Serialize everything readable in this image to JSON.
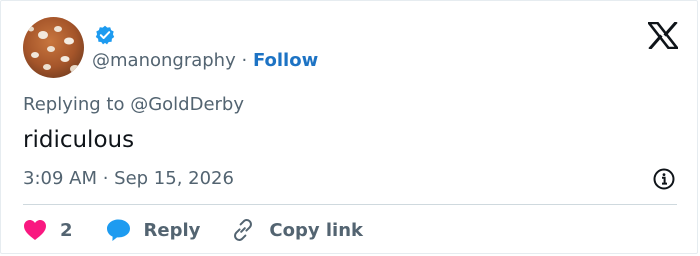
{
  "tweet": {
    "avatar": "avatar-photo",
    "verified_icon": "verified-badge-icon",
    "handle": "@manongraphy",
    "separator": "·",
    "follow_label": "Follow",
    "brand_icon": "x-logo-icon",
    "replying_to": "Replying to @GoldDerby",
    "text": "ridiculous",
    "timestamp": "3:09 AM · Sep 15, 2026",
    "info_icon": "info-icon"
  },
  "actions": {
    "like_count": "2",
    "like_icon": "heart-icon",
    "reply_label": "Reply",
    "reply_icon": "speech-bubble-icon",
    "copy_label": "Copy link",
    "copy_icon": "link-icon"
  },
  "colors": {
    "verified": "#1d9bf0",
    "follow": "#1d73c4",
    "like": "#f91880",
    "reply_icon": "#1d9bf0",
    "secondary_text": "#536471",
    "divider": "#cfd9de"
  }
}
